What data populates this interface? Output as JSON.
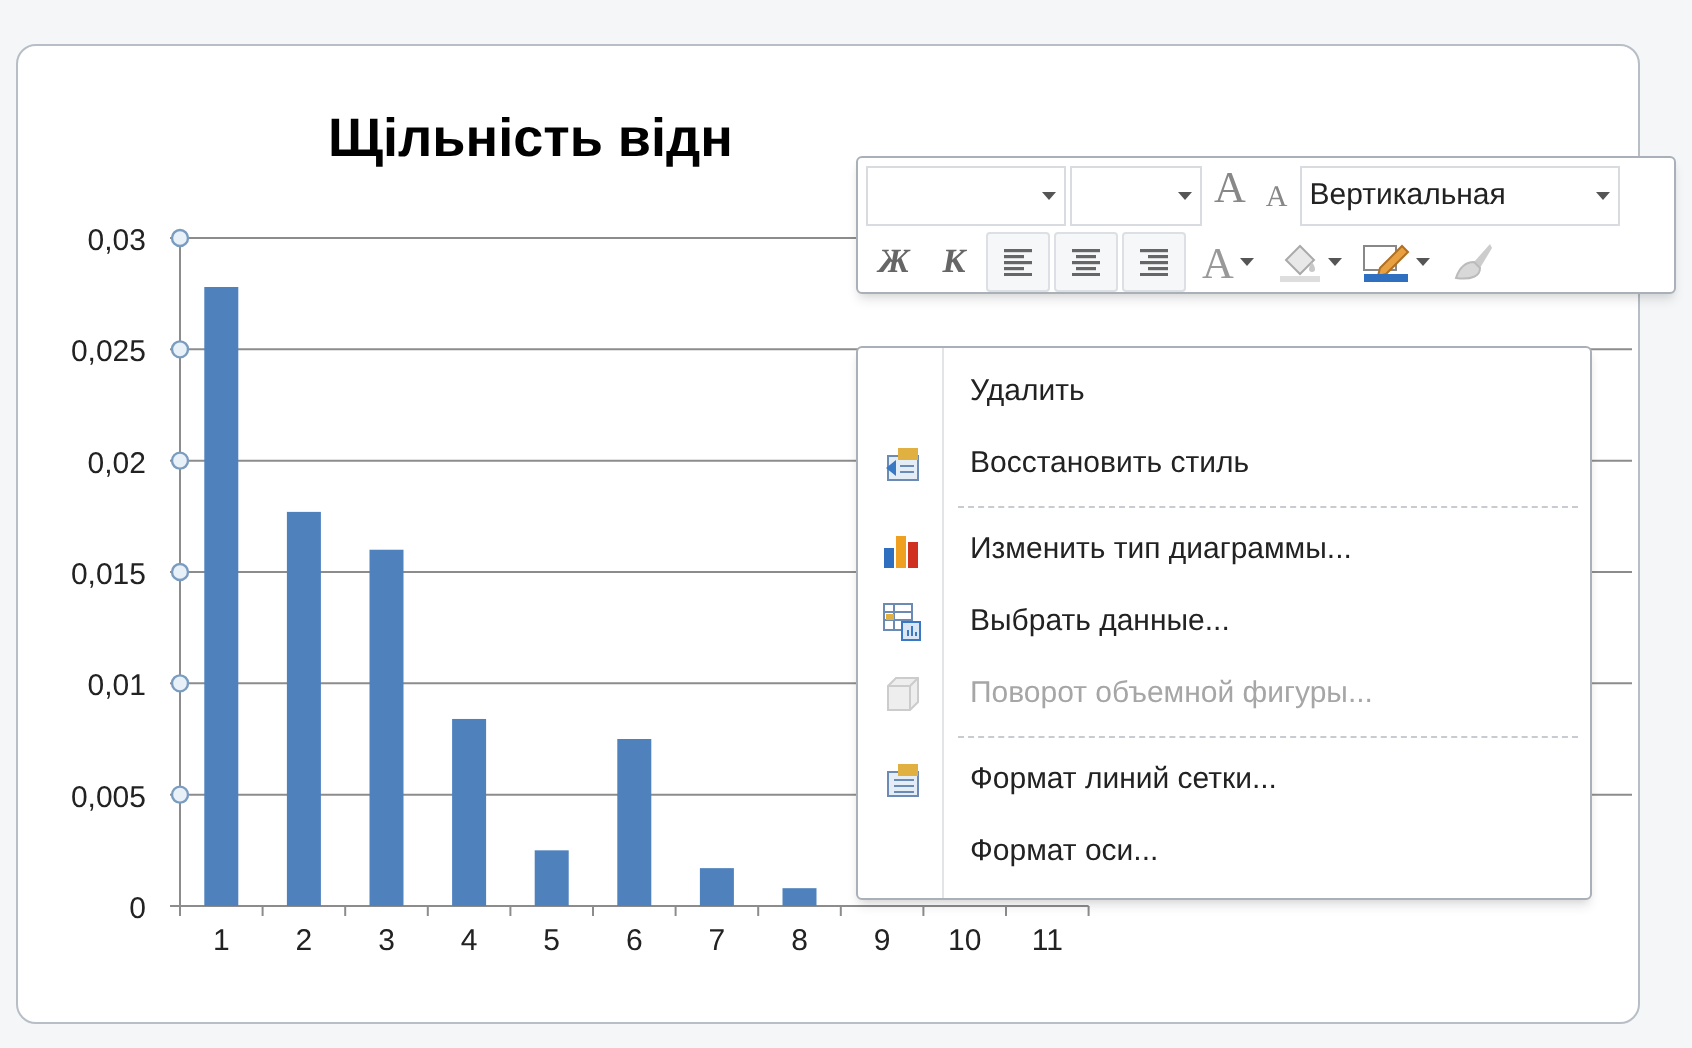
{
  "chart": {
    "title": "Щільність відн",
    "chart_data": {
      "type": "bar",
      "categories": [
        "1",
        "2",
        "3",
        "4",
        "5",
        "6",
        "7",
        "8",
        "9",
        "10",
        "11"
      ],
      "grid": true,
      "series": [
        {
          "color": "#4f81bd",
          "values": [
            0.0278,
            0.0177,
            0.016,
            0.0084,
            0.0025,
            0.0075,
            0.0017,
            0.0008,
            null,
            null,
            null
          ]
        }
      ],
      "ylim": [
        0,
        0.03
      ],
      "yticks": [
        {
          "value": 0,
          "label": "0"
        },
        {
          "value": 0.005,
          "label": "0,005"
        },
        {
          "value": 0.01,
          "label": "0,01"
        },
        {
          "value": 0.015,
          "label": "0,015"
        },
        {
          "value": 0.02,
          "label": "0,02"
        },
        {
          "value": 0.025,
          "label": "0,025"
        },
        {
          "value": 0.03,
          "label": "0,03"
        }
      ]
    }
  },
  "mini_toolbar": {
    "row_1": [
      {
        "kind": "font-combo"
      },
      {
        "kind": "size-combo"
      },
      {
        "kind": "grow-font",
        "text": "A"
      },
      {
        "kind": "shrink-font",
        "text": "A"
      },
      {
        "kind": "style-combo",
        "text": "Вертикальная"
      }
    ],
    "row_2": [
      {
        "kind": "glyph",
        "text": "Ж"
      },
      {
        "kind": "glyph",
        "text": "К"
      },
      {
        "kind": "align-left"
      },
      {
        "kind": "align-center"
      },
      {
        "kind": "align-right"
      },
      {
        "kind": "font-color",
        "text": "A"
      },
      {
        "kind": "fill"
      },
      {
        "kind": "line-color"
      },
      {
        "kind": "eraser"
      }
    ]
  },
  "context_menu": [
    {
      "kind": "item",
      "label": "Удалить",
      "disabled": false
    },
    {
      "kind": "item",
      "label": "Восстановить стиль",
      "disabled": false
    },
    {
      "kind": "separator"
    },
    {
      "kind": "item",
      "label": "Изменить тип диаграммы...",
      "disabled": false
    },
    {
      "kind": "item",
      "label": "Выбрать данные...",
      "disabled": false
    },
    {
      "kind": "item",
      "label": "Поворот объемной фигуры...",
      "disabled": true
    },
    {
      "kind": "separator"
    },
    {
      "kind": "item",
      "label": "Формат линий сетки...",
      "disabled": false
    },
    {
      "kind": "item",
      "label": "Формат оси...",
      "disabled": false
    }
  ]
}
